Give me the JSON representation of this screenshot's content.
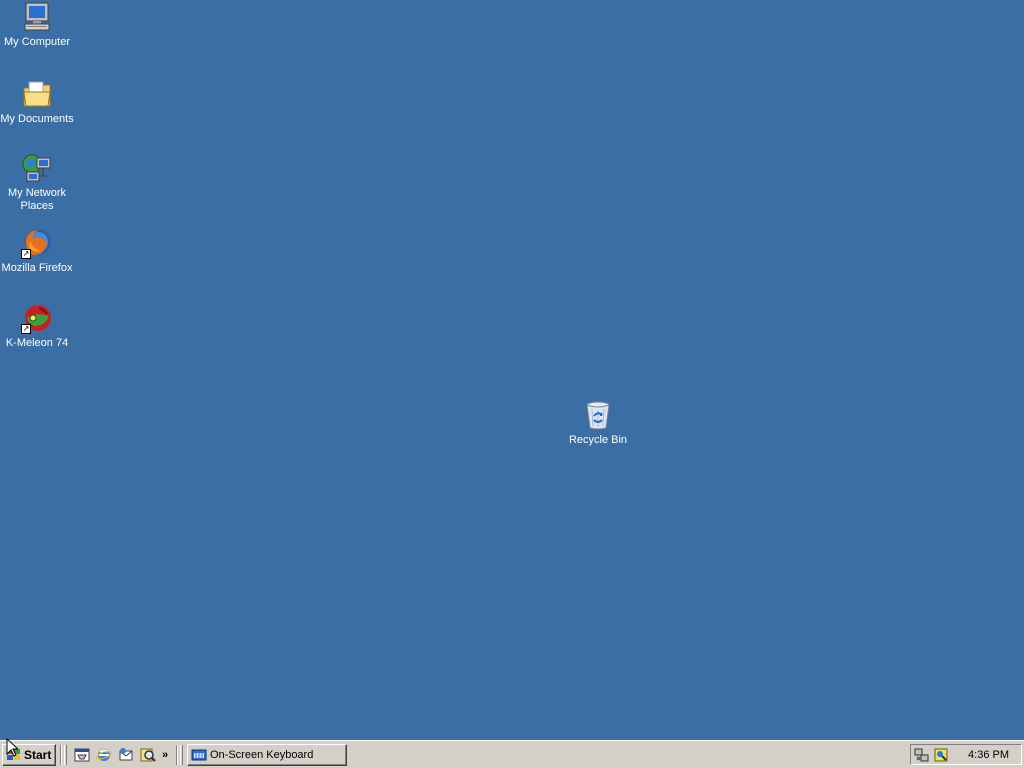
{
  "desktop": {
    "background": "#3a6ea5",
    "icons": [
      {
        "label": "My Computer",
        "icon": "my-computer-icon"
      },
      {
        "label": "My Documents",
        "icon": "my-documents-icon"
      },
      {
        "label": "My Network Places",
        "icon": "network-places-icon"
      },
      {
        "label": "Mozilla Firefox",
        "icon": "firefox-icon"
      },
      {
        "label": "K-Meleon 74",
        "icon": "k-meleon-icon"
      },
      {
        "label": "Recycle Bin",
        "icon": "recycle-bin-icon"
      }
    ]
  },
  "taskbar": {
    "start_label": "Start",
    "quick_launch": [
      "show-desktop-icon",
      "internet-explorer-icon",
      "outlook-express-icon",
      "search-icon"
    ],
    "chevron": "»",
    "tasks": [
      {
        "label": "On-Screen Keyboard",
        "icon": "keyboard-icon"
      }
    ],
    "tray": {
      "icons": [
        "network-tray-icon",
        "security-tray-icon"
      ],
      "clock": "4:36 PM"
    }
  }
}
